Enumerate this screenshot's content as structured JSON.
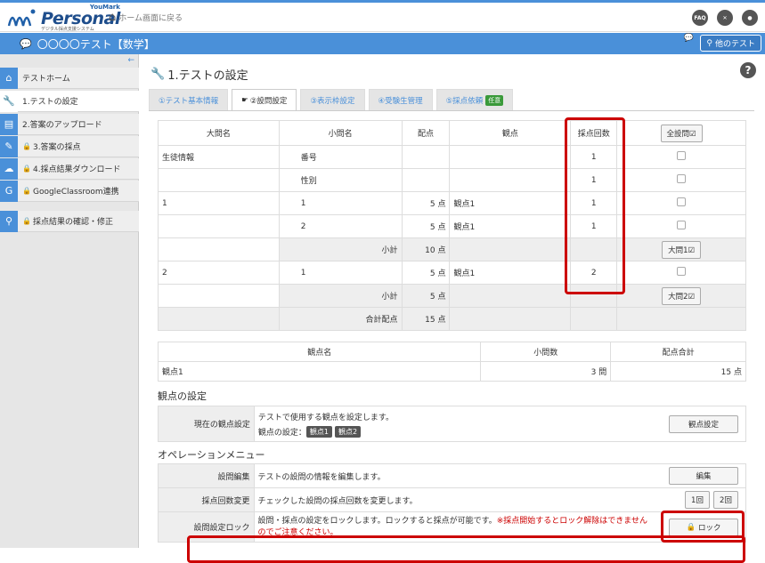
{
  "header": {
    "brand_small": "YouMark",
    "brand_name": "Personal",
    "brand_sub": "デジタル採点支援システム",
    "home_link": "ホーム画面に戻る",
    "faq": "FAQ"
  },
  "titlebar": {
    "title": "〇〇〇〇テスト【数学】",
    "other_test": "他のテスト"
  },
  "sidebar": {
    "items": [
      {
        "label": "テストホーム",
        "locked": false
      },
      {
        "label": "1.テストの設定",
        "locked": false
      },
      {
        "label": "2.答案のアップロード",
        "locked": false
      },
      {
        "label": "3.答案の採点",
        "locked": true
      },
      {
        "label": "4.採点結果ダウンロード",
        "locked": true
      },
      {
        "label": "GoogleClassroom連携",
        "locked": true
      },
      {
        "label": "採点結果の確認・修正",
        "locked": false
      }
    ]
  },
  "main": {
    "title": "1.テストの設定",
    "tabs": [
      {
        "label": "①テスト基本情報"
      },
      {
        "label": "②設問設定"
      },
      {
        "label": "③表示枠設定"
      },
      {
        "label": "④受験生管理"
      },
      {
        "label": "⑤採点依頼",
        "badge": "任意"
      }
    ]
  },
  "questions": {
    "headers": [
      "大問名",
      "小問名",
      "配点",
      "観点",
      "採点回数"
    ],
    "all_button": "全設問☑",
    "rows": [
      {
        "big": "生徒情報",
        "small": "番号",
        "score": "",
        "kanten": "",
        "count": "1"
      },
      {
        "big": "",
        "small": "性別",
        "score": "",
        "kanten": "",
        "count": "1"
      },
      {
        "big": "1",
        "small": "1",
        "score": "5 点",
        "kanten": "観点1",
        "count": "1"
      },
      {
        "big": "",
        "small": "2",
        "score": "5 点",
        "kanten": "観点1",
        "count": "1"
      },
      {
        "big": "",
        "small": "小計",
        "score": "10 点",
        "kanten": "",
        "count": "",
        "btn": "大問1☑"
      },
      {
        "big": "2",
        "small": "1",
        "score": "5 点",
        "kanten": "観点1",
        "count": "2"
      },
      {
        "big": "",
        "small": "小計",
        "score": "5 点",
        "kanten": "",
        "count": "",
        "btn": "大問2☑"
      },
      {
        "big": "",
        "small": "合計配点",
        "score": "15 点",
        "kanten": "",
        "count": ""
      }
    ]
  },
  "kanten_table": {
    "headers": [
      "観点名",
      "小問数",
      "配点合計"
    ],
    "rows": [
      {
        "name": "観点1",
        "count": "3 問",
        "total": "15 点"
      }
    ]
  },
  "kanten_settings": {
    "heading": "観点の設定",
    "label": "現在の観点設定",
    "desc": "テストで使用する観点を設定します。",
    "current_prefix": "観点の設定：",
    "badges": [
      "観点1",
      "観点2"
    ],
    "button": "観点設定"
  },
  "operations": {
    "heading": "オペレーションメニュー",
    "rows": [
      {
        "label": "設問編集",
        "desc": "テストの設問の情報を編集します。",
        "button": "編集"
      },
      {
        "label": "採点回数変更",
        "desc": "チェックした設問の採点回数を変更します。",
        "button1": "1回",
        "button2": "2回"
      },
      {
        "label": "設問設定ロック",
        "desc": "設問・採点の設定をロックします。ロックすると採点が可能です。",
        "warning": "※採点開始するとロック解除はできませんのでご注意ください。",
        "button": "ロック"
      }
    ]
  }
}
